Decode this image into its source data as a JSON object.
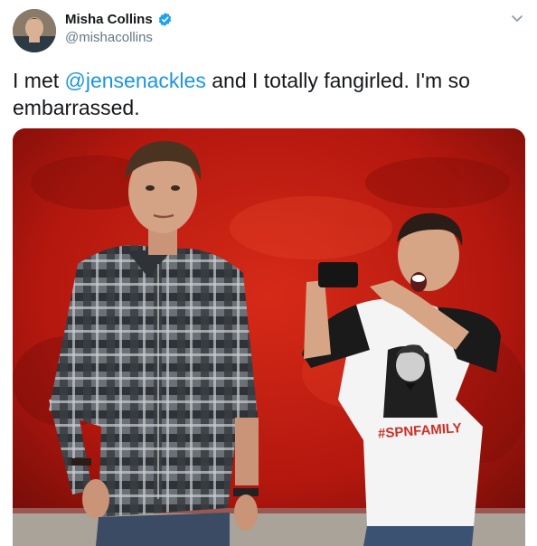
{
  "tweet": {
    "author": {
      "display_name": "Misha Collins",
      "handle": "@mishacollins",
      "verified_icon": "verified-badge-icon",
      "avatar_icon": "profile-photo"
    },
    "text_before": "I met ",
    "mention": "@jensenackles",
    "text_after": " and I totally fangirled. I'm so embarrassed.",
    "menu_icon": "chevron-down-icon",
    "media": {
      "shirt_text": "#SPNFAMILY",
      "colors": {
        "backdrop": "#b8190f",
        "flannel": "#5a5e63",
        "mention_blue": "#1b95e0",
        "verified_blue": "#1da1f2"
      }
    }
  }
}
